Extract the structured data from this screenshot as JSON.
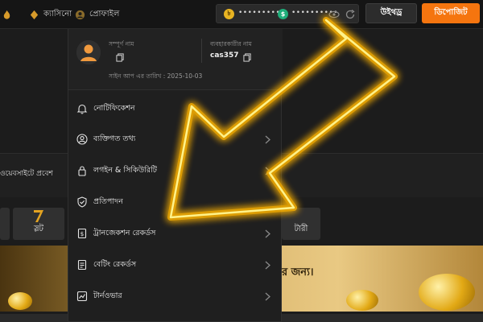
{
  "nav": {
    "items": [
      {
        "label": "",
        "icon": "flame-icon"
      },
      {
        "label": "ক্যাসিনো",
        "icon": "spade-icon"
      },
      {
        "label": "প্রোফাইল",
        "icon": "profile-icon"
      }
    ]
  },
  "wallet": {
    "main_balance": "••••••••••",
    "bonus_balance": "••••••••••",
    "main_coin_icon": "coin-icon",
    "bonus_coin_icon": "bonus-coin-icon"
  },
  "header": {
    "withdraw_label": "উইথড্র",
    "deposit_label": "ডিপোজিট"
  },
  "colors": {
    "accent": "#f5750f",
    "arrow_glow": "#ffd000",
    "background": "#1c1c1c"
  },
  "profile": {
    "fullname_label": "সম্পূর্ণ নাম",
    "fullname_value": "",
    "username_label": "ব্যবহারকারীর নাম",
    "username_value": "cas357",
    "signup_label": "সাইন আপ এর তারিখ",
    "signup_date": "2025-10-03"
  },
  "menu": {
    "items": [
      {
        "label": "নোটিফিকেশন",
        "icon": "bell-icon",
        "chevron": false
      },
      {
        "label": "ব্যক্তিগত তথ্য",
        "icon": "user-circle-icon",
        "chevron": true
      },
      {
        "label": "লগইন & সিকিউরিটি",
        "icon": "lock-icon",
        "chevron": true
      },
      {
        "label": "প্রতিপাদন",
        "icon": "shield-check-icon",
        "chevron": false
      },
      {
        "label": "ট্রানজেকশন রেকর্ডস",
        "icon": "transaction-icon",
        "chevron": true
      },
      {
        "label": "বেটিং রেকর্ডস",
        "icon": "ticket-icon",
        "chevron": true
      },
      {
        "label": "টার্নওভার",
        "icon": "turnover-icon",
        "chevron": true
      }
    ]
  },
  "background": {
    "marquee_text": "ওয়েবসাইটে প্রবেশ",
    "category_left": "স্লট",
    "category_right": "টারী",
    "banner_text": "র জন্য।"
  }
}
